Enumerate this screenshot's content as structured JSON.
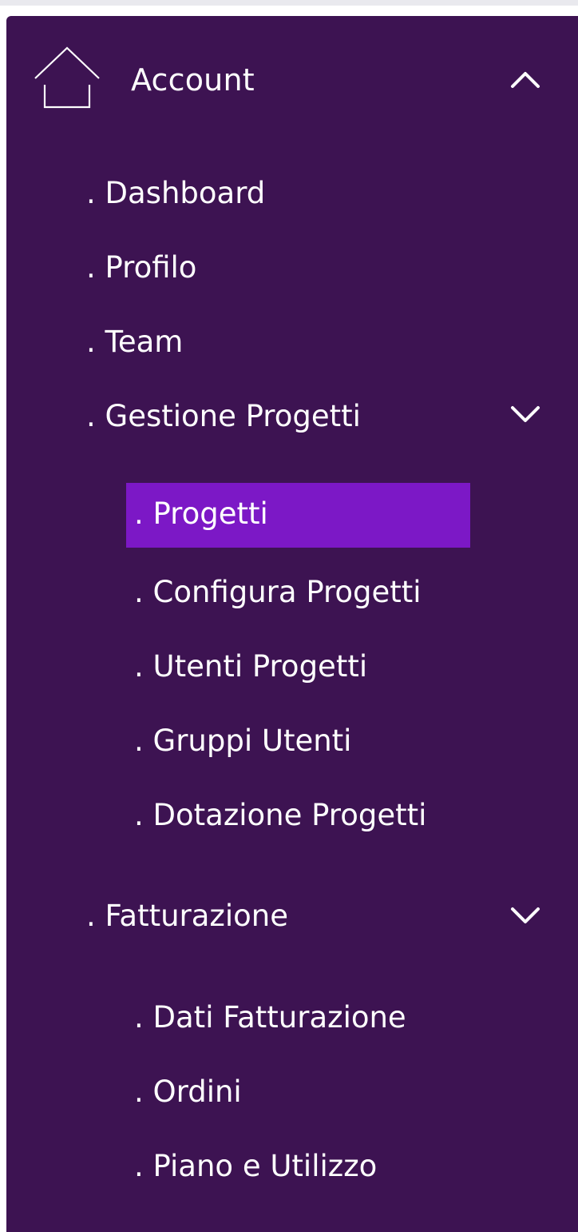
{
  "colors": {
    "sidebar_bg": "#3d1352",
    "active_bg": "#7c18c6",
    "text": "#ffffff"
  },
  "header": {
    "icon": "home-icon",
    "label": "Account",
    "toggle_icon": "chevron-up-icon",
    "expanded": true
  },
  "menu": {
    "dashboard": ". Dashboard",
    "profilo": ". Profilo",
    "team": ". Team",
    "gestione_progetti": {
      "label": ". Gestione Progetti",
      "toggle_icon": "chevron-down-icon",
      "items": {
        "progetti": ". Progetti",
        "configura_progetti": ". Configura Progetti",
        "utenti_progetti": ". Utenti Progetti",
        "gruppi_utenti": ". Gruppi Utenti",
        "dotazione_progetti": ". Dotazione Progetti"
      },
      "active_item": ". Progetti"
    },
    "fatturazione": {
      "label": ". Fatturazione",
      "toggle_icon": "chevron-down-icon",
      "items": {
        "dati_fatturazione": ". Dati Fatturazione",
        "ordini": ". Ordini",
        "piano_e_utilizzo": ". Piano e Utilizzo"
      }
    }
  }
}
